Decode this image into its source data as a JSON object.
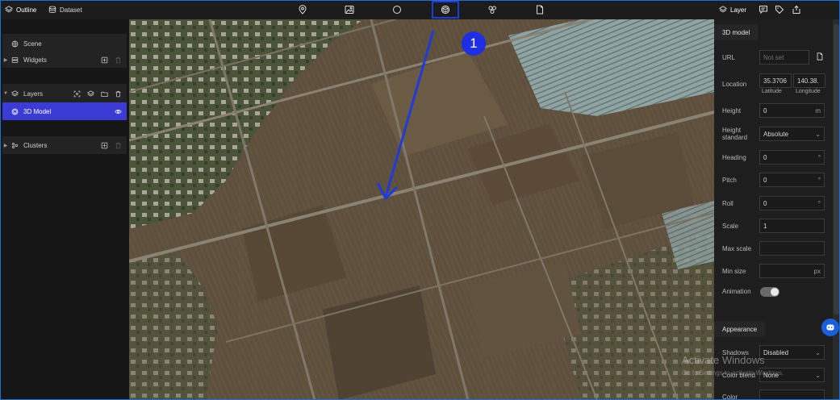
{
  "header": {
    "tabs": [
      {
        "label": "Outline",
        "icon": "layers-icon",
        "active": true
      },
      {
        "label": "Dataset",
        "icon": "database-icon",
        "active": false
      }
    ],
    "tools": [
      {
        "icon": "map-pin-icon"
      },
      {
        "icon": "image-icon"
      },
      {
        "icon": "circle-icon"
      },
      {
        "icon": "model-3d-icon",
        "highlighted": true
      },
      {
        "icon": "clusters-icon"
      },
      {
        "icon": "file-icon"
      }
    ],
    "right_tabs": [
      {
        "label": "Layer",
        "icon": "layers-icon",
        "active": true
      },
      {
        "icon": "comment-icon"
      },
      {
        "icon": "tag-icon"
      },
      {
        "icon": "export-icon"
      }
    ]
  },
  "outline": {
    "scene_label": "Scene",
    "widgets_label": "Widgets",
    "layers_label": "Layers",
    "model_label": "3D Model",
    "clusters_label": "Clusters"
  },
  "annotation": {
    "step_number": "1",
    "color": "#1f3bd9"
  },
  "properties": {
    "section_title": "3D model",
    "url_label": "URL",
    "url_placeholder": "Not set",
    "location_label": "Location",
    "latitude_value": "35.3706",
    "longitude_value": "140.38.",
    "latitude_label": "Latitude",
    "longitude_label": "Longitude",
    "height_label": "Height",
    "height_value": "0",
    "height_unit": "m",
    "height_standard_label": "Height standard",
    "height_standard_value": "Absolute",
    "heading_label": "Heading",
    "heading_value": "0",
    "pitch_label": "Pitch",
    "pitch_value": "0",
    "roll_label": "Roll",
    "roll_value": "0",
    "degree_unit": "°",
    "scale_label": "Scale",
    "scale_value": "1",
    "max_scale_label": "Max scale",
    "min_size_label": "Min size",
    "min_size_unit": "px",
    "animation_label": "Animation",
    "animation_on": true,
    "appearance_title": "Appearance",
    "shadows_label": "Shadows",
    "shadows_value": "Disabled",
    "color_blend_label": "Color blend",
    "color_blend_value": "None",
    "color_label": "Color"
  },
  "watermark": {
    "title": "Activate Windows",
    "subtitle": "Go to Settings to activate Windows."
  },
  "colors": {
    "accent": "#3b3bd6",
    "annotation": "#1f3bd9",
    "chat_button": "#1a5fd8"
  }
}
